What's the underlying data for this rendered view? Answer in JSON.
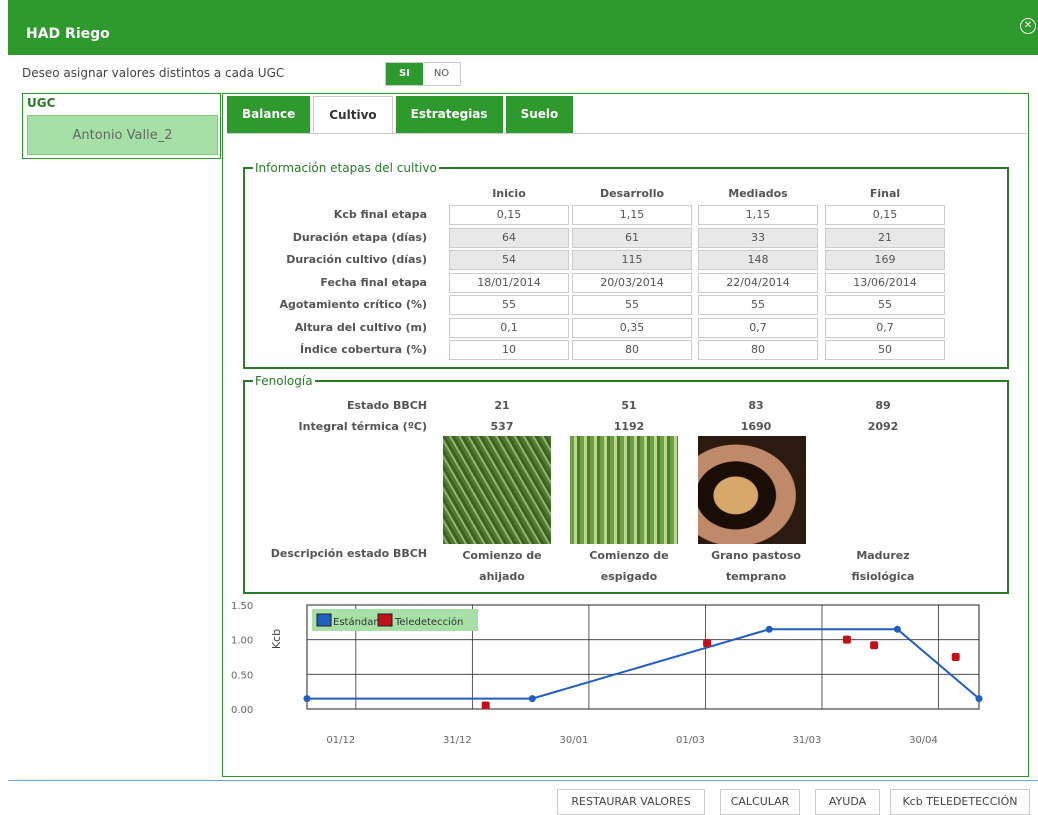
{
  "window": {
    "title": "HAD Riego",
    "close_icon": "close-circle-icon"
  },
  "assign": {
    "label": "Deseo asignar valores distintos a cada UGC",
    "yes": "SI",
    "no": "NO"
  },
  "ugc": {
    "label": "UGC",
    "selected": "Antonio Valle_2"
  },
  "tabs": [
    {
      "label": "Balance",
      "active": false
    },
    {
      "label": "Cultivo",
      "active": true
    },
    {
      "label": "Estrategias",
      "active": false
    },
    {
      "label": "Suelo",
      "active": false
    }
  ],
  "stages": {
    "legend": "Información etapas del cultivo",
    "columns": [
      "Inicio",
      "Desarrollo",
      "Mediados",
      "Final"
    ],
    "rows": [
      {
        "label": "Kcb final etapa",
        "values": [
          "0,15",
          "1,15",
          "1,15",
          "0,15"
        ],
        "readonly": false
      },
      {
        "label": "Duración etapa (días)",
        "values": [
          "64",
          "61",
          "33",
          "21"
        ],
        "readonly": true
      },
      {
        "label": "Duración cultivo (días)",
        "values": [
          "54",
          "115",
          "148",
          "169"
        ],
        "readonly": true
      },
      {
        "label": "Fecha final etapa",
        "values": [
          "18/01/2014",
          "20/03/2014",
          "22/04/2014",
          "13/06/2014"
        ],
        "readonly": false
      },
      {
        "label": "Agotamiento crítico (%)",
        "values": [
          "55",
          "55",
          "55",
          "55"
        ],
        "readonly": false
      },
      {
        "label": "Altura del cultivo (m)",
        "values": [
          "0,1",
          "0,35",
          "0,7",
          "0,7"
        ],
        "readonly": false
      },
      {
        "label": "Índice cobertura (%)",
        "values": [
          "10",
          "80",
          "80",
          "50"
        ],
        "readonly": false
      }
    ]
  },
  "pheno": {
    "legend": "Fenología",
    "bbch_label": "Estado BBCH",
    "bbch": [
      "21",
      "51",
      "83",
      "89"
    ],
    "thermal_label": "Integral térmica (ºC)",
    "thermal": [
      "537",
      "1192",
      "1690",
      "2092"
    ],
    "desc_label": "Descripción estado BBCH",
    "descriptions": [
      [
        "Comienzo de",
        "ahijado"
      ],
      [
        "Comienzo de",
        "espigado"
      ],
      [
        "Grano pastoso",
        "temprano"
      ],
      [
        "Madurez",
        "fisiológica"
      ]
    ],
    "image_colors": [
      "#5f8a3f",
      "#8dbb5e",
      "#6b4a2a"
    ]
  },
  "chart_data": {
    "type": "line",
    "ylabel": "Kcb",
    "ylim": [
      0,
      1.5
    ],
    "yticks": [
      "0.00",
      "0.50",
      "1.00",
      "1.50"
    ],
    "xticks": [
      "01/12",
      "31/12",
      "30/01",
      "01/03",
      "31/03",
      "30/04"
    ],
    "legend_position": "top-left",
    "series": [
      {
        "name": "Estándar",
        "color": "#1f5fc0",
        "points": [
          [
            "2013-11-21",
            0.15
          ],
          [
            "2014-01-18",
            0.15
          ],
          [
            "2014-03-20",
            1.15
          ],
          [
            "2014-04-22",
            1.15
          ],
          [
            "2014-05-13",
            0.15
          ]
        ]
      },
      {
        "name": "Teledetección",
        "color": "#c0101a",
        "points": [
          [
            "2014-01-06",
            0.05
          ],
          [
            "2014-03-04",
            0.95
          ],
          [
            "2014-04-09",
            1.0
          ],
          [
            "2014-04-16",
            0.92
          ],
          [
            "2014-05-07",
            0.75
          ]
        ]
      }
    ]
  },
  "footer": {
    "restore": "RESTAURAR VALORES",
    "calculate": "CALCULAR",
    "help": "AYUDA",
    "kcb": "Kcb TELEDETECCIÓN"
  }
}
